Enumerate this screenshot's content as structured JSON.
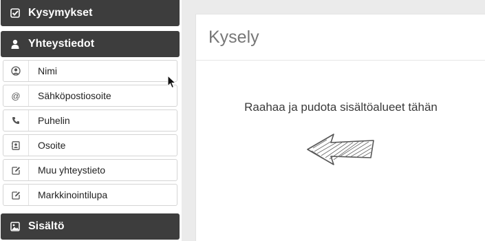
{
  "sidebar": {
    "sections": {
      "kysymykset": {
        "label": "Kysymykset",
        "icon": "checkbox-icon"
      },
      "yhteystiedot": {
        "label": "Yhteystiedot",
        "icon": "user-icon"
      },
      "sisalto": {
        "label": "Sisältö",
        "icon": "image-icon"
      }
    },
    "items": [
      {
        "label": "Nimi",
        "icon": "user-circle-icon"
      },
      {
        "label": "Sähköpostiosoite",
        "icon": "at-icon"
      },
      {
        "label": "Puhelin",
        "icon": "phone-icon"
      },
      {
        "label": "Osoite",
        "icon": "address-card-icon"
      },
      {
        "label": "Muu yhteystieto",
        "icon": "edit-icon"
      },
      {
        "label": "Markkinointilupa",
        "icon": "edit-icon"
      }
    ]
  },
  "main": {
    "title": "Kysely",
    "drop_hint": "Raahaa ja pudota sisältöalueet tähän"
  },
  "colors": {
    "header_bg": "#3d3d3d",
    "canvas_bg": "#ebebeb",
    "title_text": "#777777"
  }
}
